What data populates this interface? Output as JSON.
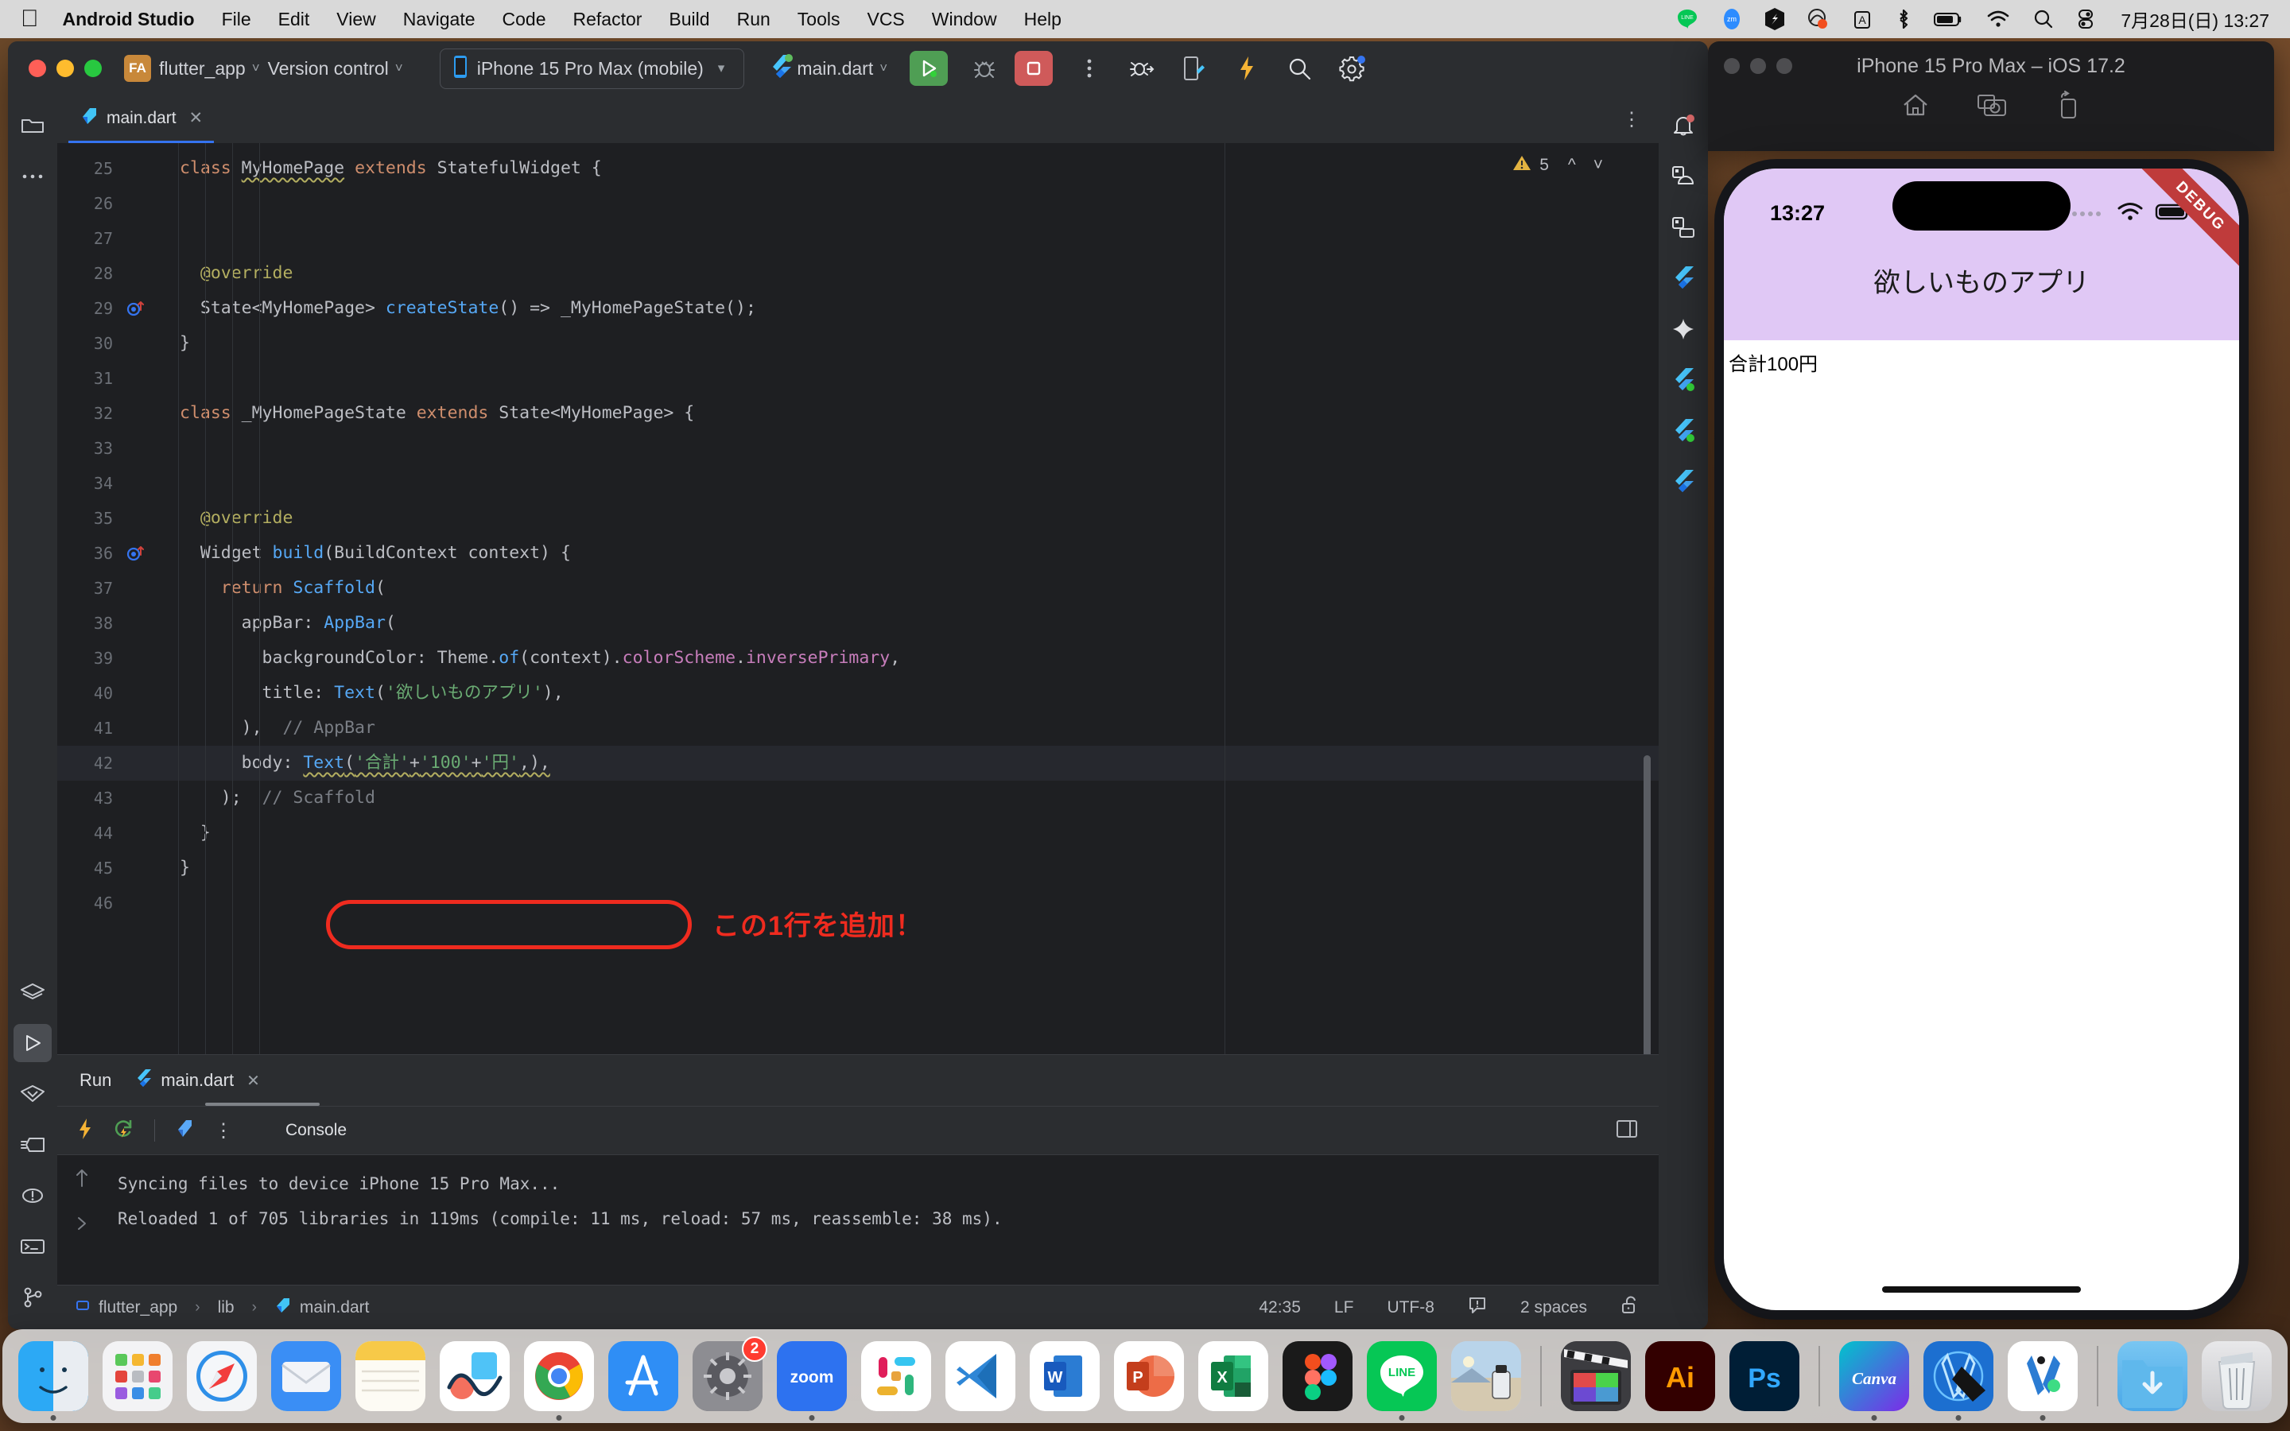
{
  "menubar": {
    "apple_icon": "apple-icon",
    "app_name": "Android Studio",
    "items": [
      "File",
      "Edit",
      "View",
      "Navigate",
      "Code",
      "Refactor",
      "Build",
      "Run",
      "Tools",
      "VCS",
      "Window",
      "Help"
    ],
    "status_icons": [
      "line-icon",
      "zoom-icon",
      "sessionbuddy-icon",
      "unknown-app-icon",
      "input-source-icon",
      "bluetooth-icon",
      "battery-icon",
      "wifi-icon",
      "search-icon",
      "control-center-icon"
    ],
    "input_source_label": "A",
    "clock": "7月28日(日)  13:27"
  },
  "ide": {
    "toolbar": {
      "project_badge": "FA",
      "project_name": "flutter_app",
      "version_control_label": "Version control",
      "device_label": "iPhone 15 Pro Max (mobile)",
      "run_config_label": "main.dart",
      "icons": [
        "phone-icon",
        "flutter-icon",
        "run-icon",
        "debug-icon",
        "stop-icon",
        "more-options-icon",
        "attach-debugger-icon",
        "device-mirror-icon",
        "hot-reload-icon",
        "search-everywhere-icon",
        "settings-icon"
      ]
    },
    "left_rail": [
      "project-icon",
      "more-tool-windows-icon",
      "layers-icon",
      "run-icon",
      "debug-icon",
      "build-icon",
      "problems-icon",
      "terminal-icon",
      "version-control-icon"
    ],
    "right_rail": [
      "notifications-icon",
      "device-manager-icon",
      "running-devices-icon",
      "flutter-inspector-icon",
      "gemini-icon",
      "flutter-performance-icon",
      "flutter-outline-icon",
      "flutter-devtools-icon"
    ],
    "editor_tab": {
      "label": "main.dart",
      "close_label": "✕"
    },
    "warnings": {
      "count": "5",
      "icon": "warning-icon"
    },
    "code_lines": [
      {
        "num": "25",
        "gutter": "",
        "tokens": [
          {
            "t": "class ",
            "c": "kw"
          },
          {
            "t": "MyHomePage",
            "c": "cls wavy"
          },
          {
            "t": " ",
            "c": ""
          },
          {
            "t": "extends",
            "c": "kw"
          },
          {
            "t": " StatefulWidget {",
            "c": ""
          }
        ]
      },
      {
        "num": "26",
        "gutter": "",
        "tokens": []
      },
      {
        "num": "27",
        "gutter": "",
        "tokens": []
      },
      {
        "num": "28",
        "gutter": "",
        "tokens": [
          {
            "t": "  ",
            "c": ""
          },
          {
            "t": "@override",
            "c": "ann"
          }
        ]
      },
      {
        "num": "29",
        "gutter": "override-icon",
        "tokens": [
          {
            "t": "  State<MyHomePage> ",
            "c": ""
          },
          {
            "t": "createState",
            "c": "fn"
          },
          {
            "t": "() => _MyHomePageState();",
            "c": ""
          }
        ]
      },
      {
        "num": "30",
        "gutter": "",
        "tokens": [
          {
            "t": "}",
            "c": ""
          }
        ]
      },
      {
        "num": "31",
        "gutter": "",
        "tokens": []
      },
      {
        "num": "32",
        "gutter": "",
        "tokens": [
          {
            "t": "class ",
            "c": "kw"
          },
          {
            "t": "_MyHomePageState ",
            "c": ""
          },
          {
            "t": "extends",
            "c": "kw"
          },
          {
            "t": " State<MyHomePage> {",
            "c": ""
          }
        ]
      },
      {
        "num": "33",
        "gutter": "",
        "tokens": []
      },
      {
        "num": "34",
        "gutter": "",
        "tokens": []
      },
      {
        "num": "35",
        "gutter": "",
        "tokens": [
          {
            "t": "  ",
            "c": ""
          },
          {
            "t": "@override",
            "c": "ann"
          }
        ]
      },
      {
        "num": "36",
        "gutter": "override-icon",
        "tokens": [
          {
            "t": "  Widget ",
            "c": ""
          },
          {
            "t": "build",
            "c": "fn"
          },
          {
            "t": "(BuildContext context) {",
            "c": ""
          }
        ]
      },
      {
        "num": "37",
        "gutter": "",
        "tokens": [
          {
            "t": "    ",
            "c": ""
          },
          {
            "t": "return",
            "c": "kw"
          },
          {
            "t": " ",
            "c": ""
          },
          {
            "t": "Scaffold",
            "c": "fn"
          },
          {
            "t": "(",
            "c": ""
          }
        ]
      },
      {
        "num": "38",
        "gutter": "",
        "tokens": [
          {
            "t": "      appBar: ",
            "c": ""
          },
          {
            "t": "AppBar",
            "c": "fn"
          },
          {
            "t": "(",
            "c": ""
          }
        ]
      },
      {
        "num": "39",
        "gutter": "",
        "tokens": [
          {
            "t": "        backgroundColor: Theme.",
            "c": ""
          },
          {
            "t": "of",
            "c": "fn"
          },
          {
            "t": "(context).",
            "c": ""
          },
          {
            "t": "colorScheme",
            "c": "prop"
          },
          {
            "t": ".",
            "c": ""
          },
          {
            "t": "inversePrimary",
            "c": "prop"
          },
          {
            "t": ",",
            "c": ""
          }
        ]
      },
      {
        "num": "40",
        "gutter": "",
        "tokens": [
          {
            "t": "        title: ",
            "c": ""
          },
          {
            "t": "Text",
            "c": "fn"
          },
          {
            "t": "(",
            "c": ""
          },
          {
            "t": "'欲しいものアプリ'",
            "c": "str"
          },
          {
            "t": "),",
            "c": ""
          }
        ]
      },
      {
        "num": "41",
        "gutter": "",
        "tokens": [
          {
            "t": "      ),  ",
            "c": ""
          },
          {
            "t": "// AppBar",
            "c": "cmt"
          }
        ]
      },
      {
        "num": "42",
        "gutter": "",
        "highlight": true,
        "tokens": [
          {
            "t": "      body: ",
            "c": ""
          },
          {
            "t": "Text",
            "c": "fn wavy"
          },
          {
            "t": "(",
            "c": "wavy"
          },
          {
            "t": "'合計'",
            "c": "str wavy"
          },
          {
            "t": "+",
            "c": "wavy"
          },
          {
            "t": "'100'",
            "c": "str wavy"
          },
          {
            "t": "+",
            "c": "wavy"
          },
          {
            "t": "'円'",
            "c": "str wavy"
          },
          {
            "t": ",),",
            "c": "wavy"
          }
        ]
      },
      {
        "num": "43",
        "gutter": "",
        "tokens": [
          {
            "t": "    );  ",
            "c": ""
          },
          {
            "t": "// Scaffold",
            "c": "cmt"
          }
        ]
      },
      {
        "num": "44",
        "gutter": "",
        "tokens": [
          {
            "t": "  }",
            "c": ""
          }
        ]
      },
      {
        "num": "45",
        "gutter": "",
        "tokens": [
          {
            "t": "}",
            "c": ""
          }
        ]
      },
      {
        "num": "46",
        "gutter": "",
        "tokens": []
      }
    ],
    "annotation": {
      "text": "この1行を追加！",
      "color": "#ef2b1f",
      "shape": "oval-highlight"
    },
    "run_panel": {
      "title": "Run",
      "tab_label": "main.dart",
      "tab_close": "✕",
      "console_label": "Console",
      "toolbar_icons": [
        "hot-reload-icon",
        "hot-restart-icon",
        "open-devtools-icon",
        "more-options-icon",
        "layout-icon"
      ],
      "gutter_icons": [
        "scroll-up-icon",
        "expand-icon"
      ],
      "output": [
        "Syncing files to device iPhone 15 Pro Max...",
        "Reloaded 1 of 705 libraries in 119ms (compile: 11 ms, reload: 57 ms, reassemble: 38 ms)."
      ]
    },
    "statusbar": {
      "breadcrumb": [
        "flutter_app",
        "lib",
        "main.dart"
      ],
      "caret_position": "42:35",
      "line_separator": "LF",
      "encoding": "UTF-8",
      "indent": "2 spaces",
      "icons": [
        "module-icon",
        "dart-file-icon",
        "inspections-icon",
        "lock-icon"
      ]
    }
  },
  "simulator": {
    "window_title": "iPhone 15 Pro Max – iOS 17.2",
    "controls": [
      "home-icon",
      "screenshot-icon",
      "rotate-icon"
    ],
    "screen": {
      "status_time": "13:27",
      "status_icons": [
        "cellular-icon",
        "wifi-icon",
        "battery-icon"
      ],
      "app_bar_title": "欲しいものアプリ",
      "app_bar_color": "#e0c8f5",
      "body_text": "合計100円",
      "debug_ribbon": "DEBUG"
    }
  },
  "dock": {
    "items": [
      {
        "name": "finder-icon",
        "label": "",
        "running": true
      },
      {
        "name": "launchpad-icon",
        "label": "",
        "running": false
      },
      {
        "name": "safari-icon",
        "label": "",
        "running": false
      },
      {
        "name": "mail-icon",
        "label": "",
        "running": false
      },
      {
        "name": "notes-icon",
        "label": "",
        "running": false
      },
      {
        "name": "freeform-icon",
        "label": "",
        "running": false
      },
      {
        "name": "chrome-icon",
        "label": "",
        "running": true
      },
      {
        "name": "app-store-icon",
        "label": "",
        "running": false
      },
      {
        "name": "system-settings-icon",
        "label": "",
        "running": false,
        "badge": "2"
      },
      {
        "name": "zoom-icon",
        "label": "zoom",
        "running": true
      },
      {
        "name": "slack-icon",
        "label": "",
        "running": false
      },
      {
        "name": "vscode-icon",
        "label": "",
        "running": false
      },
      {
        "name": "word-icon",
        "label": "W",
        "running": false
      },
      {
        "name": "powerpoint-icon",
        "label": "P",
        "running": false
      },
      {
        "name": "excel-icon",
        "label": "X",
        "running": false
      },
      {
        "name": "figma-icon",
        "label": "",
        "running": false
      },
      {
        "name": "line-icon",
        "label": "LINE",
        "running": true
      },
      {
        "name": "preview-icon",
        "label": "",
        "running": false
      },
      {
        "name": "final-cut-pro-icon",
        "label": "",
        "running": false
      },
      {
        "name": "illustrator-icon",
        "label": "Ai",
        "running": false
      },
      {
        "name": "photoshop-icon",
        "label": "Ps",
        "running": false
      },
      {
        "name": "canva-icon",
        "label": "Canva",
        "running": true
      },
      {
        "name": "xcode-icon",
        "label": "",
        "running": true
      },
      {
        "name": "android-studio-icon",
        "label": "",
        "running": true
      },
      {
        "name": "downloads-folder-icon",
        "label": "",
        "running": false
      },
      {
        "name": "trash-icon",
        "label": "",
        "running": false
      }
    ]
  }
}
